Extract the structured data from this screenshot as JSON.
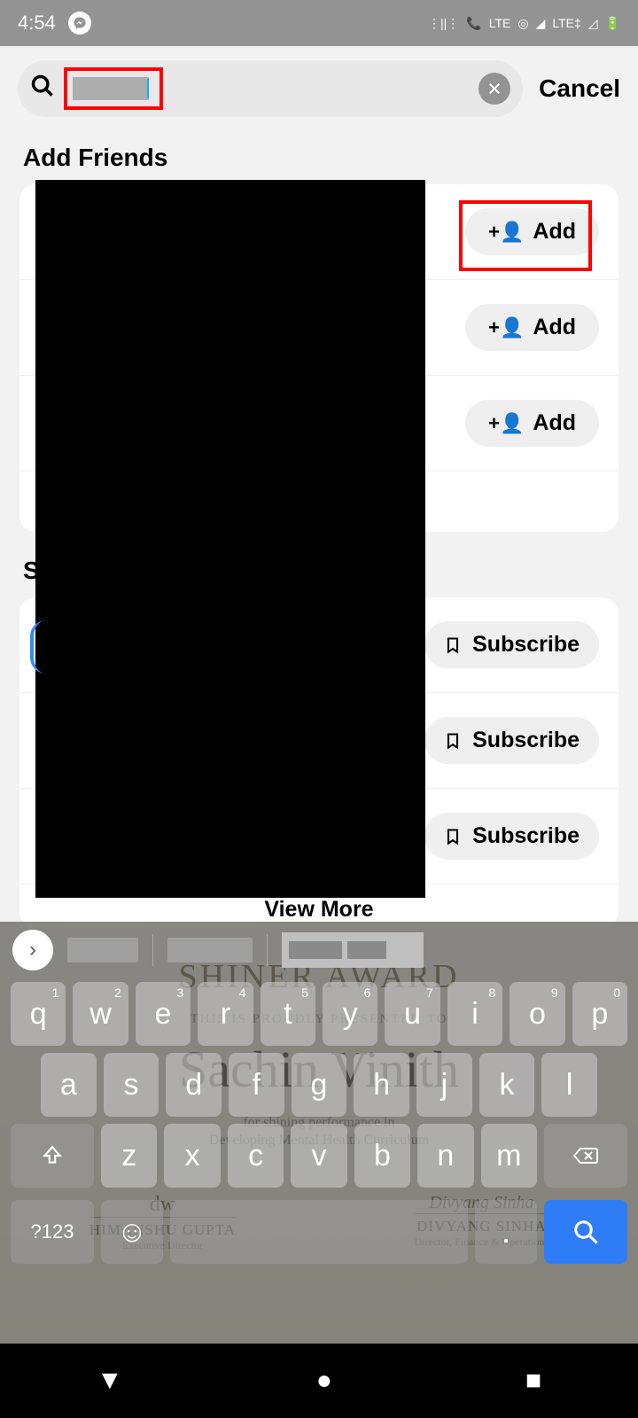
{
  "status": {
    "time": "4:54",
    "lte": "LTE",
    "lte2": "LTE‡"
  },
  "search": {
    "cancel": "Cancel"
  },
  "sections": {
    "addFriends": "Add Friends",
    "s2prefix": "S",
    "viewMore": "View More"
  },
  "buttons": {
    "add": "Add",
    "subscribe": "Subscribe"
  },
  "certificate": {
    "title": "SHINER AWARD",
    "presented": "THIS IS PROUDLY PRESENTED TO",
    "name": "Sachin Vinith",
    "reason1": "for shining performance in",
    "reason2": "Developing Mental Health Curriculum",
    "sig1": "HIMANSHU GUPTA",
    "role1": "Executive Director",
    "sig2": "DIVYANG SINHA",
    "role2": "Director, Finance & Operations"
  },
  "keys": {
    "row1": [
      {
        "k": "q",
        "n": "1"
      },
      {
        "k": "w",
        "n": "2"
      },
      {
        "k": "e",
        "n": "3"
      },
      {
        "k": "r",
        "n": "4"
      },
      {
        "k": "t",
        "n": "5"
      },
      {
        "k": "y",
        "n": "6"
      },
      {
        "k": "u",
        "n": "7"
      },
      {
        "k": "i",
        "n": "8"
      },
      {
        "k": "o",
        "n": "9"
      },
      {
        "k": "p",
        "n": "0"
      }
    ],
    "row2": [
      "a",
      "s",
      "d",
      "f",
      "g",
      "h",
      "j",
      "k",
      "l"
    ],
    "row3": [
      "z",
      "x",
      "c",
      "v",
      "b",
      "n",
      "m"
    ],
    "symbols": "?123"
  }
}
